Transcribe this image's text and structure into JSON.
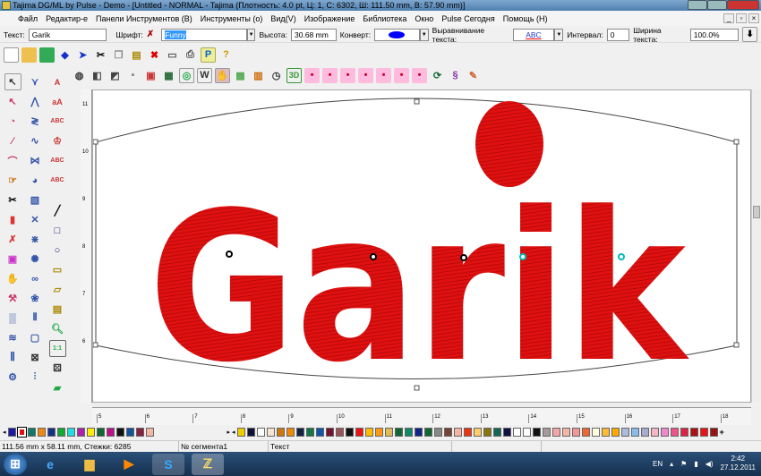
{
  "window": {
    "title": "Tajima DG/ML by Pulse - Demo - [Untitled - NORMAL - Tajima (Плотность: 4.0 pt, Ц: 1, С: 6302, Ш: 111.50 mm, В: 57.90 mm)]"
  },
  "menu": [
    "Файл",
    "Редактир-е",
    "Панели Инструментов (В)",
    "Инструменты (о)",
    "Вид(V)",
    "Изображение",
    "Библиотека",
    "Окно",
    "Pulse Сегодня",
    "Помощь (H)"
  ],
  "text_toolbar": {
    "text_label": "Текст:",
    "text_value": "Garik",
    "font_label": "Шрифт:",
    "font_value": "Funny",
    "height_label": "Высота:",
    "height_value": "30.68 mm",
    "envelope_label": "Конверт:",
    "align_label": "Выравнивание текста:",
    "align_value": "ABC",
    "interval_label": "Интервал:",
    "interval_value": "0",
    "width_label": "Ширина текста:",
    "width_value": "100.0%"
  },
  "canvas": {
    "design_text": "Garik",
    "design_color": "#e01010"
  },
  "vruler": [
    "11",
    "10",
    "9",
    "8",
    "7",
    "6"
  ],
  "hruler": [
    "5",
    "6",
    "7",
    "8",
    "9",
    "10",
    "11",
    "12",
    "13",
    "14",
    "15",
    "16",
    "17",
    "18"
  ],
  "palette_left": [
    "#1a1aa0",
    "#e01010",
    "#117766",
    "#ee8811",
    "#113388",
    "#11aa33",
    "#22dddd",
    "#aa22aa",
    "#ffee00",
    "#116633",
    "#bb1188",
    "#111111",
    "#115599",
    "#882244",
    "#f5b5a5"
  ],
  "palette_right": [
    "#eecc00",
    "#111133",
    "#ffffff",
    "#f5e5d0",
    "#cc7711",
    "#ee8800",
    "#112244",
    "#117744",
    "#1155aa",
    "#771133",
    "#995555",
    "#111111",
    "#ee1111",
    "#ffbb00",
    "#ff9911",
    "#ddbb55",
    "#116633",
    "#118866",
    "#112288",
    "#116633",
    "#888888",
    "#774433",
    "#f5b5a5",
    "#ee3311",
    "#ffcc66",
    "#887711",
    "#116655",
    "#111144",
    "#ffffff",
    "#ffffff",
    "#111111",
    "#aa9999",
    "#f5a5a5",
    "#f5b5a5",
    "#f59595",
    "#ee6633",
    "#ffffdd",
    "#ffbb33",
    "#ffaa00",
    "#aabbdd",
    "#88bbee",
    "#aaaacc",
    "#f5b5c5",
    "#ee88cc",
    "#ee5588",
    "#dd2244",
    "#aa1111",
    "#ee1111",
    "#991111"
  ],
  "status": {
    "size": "111.56 mm x 58.11 mm, Стежки: 6285",
    "segment": "№ сегмента1",
    "type": "Текст"
  },
  "tray": {
    "lang": "EN",
    "time": "2:42",
    "date": "27.12.2011"
  }
}
